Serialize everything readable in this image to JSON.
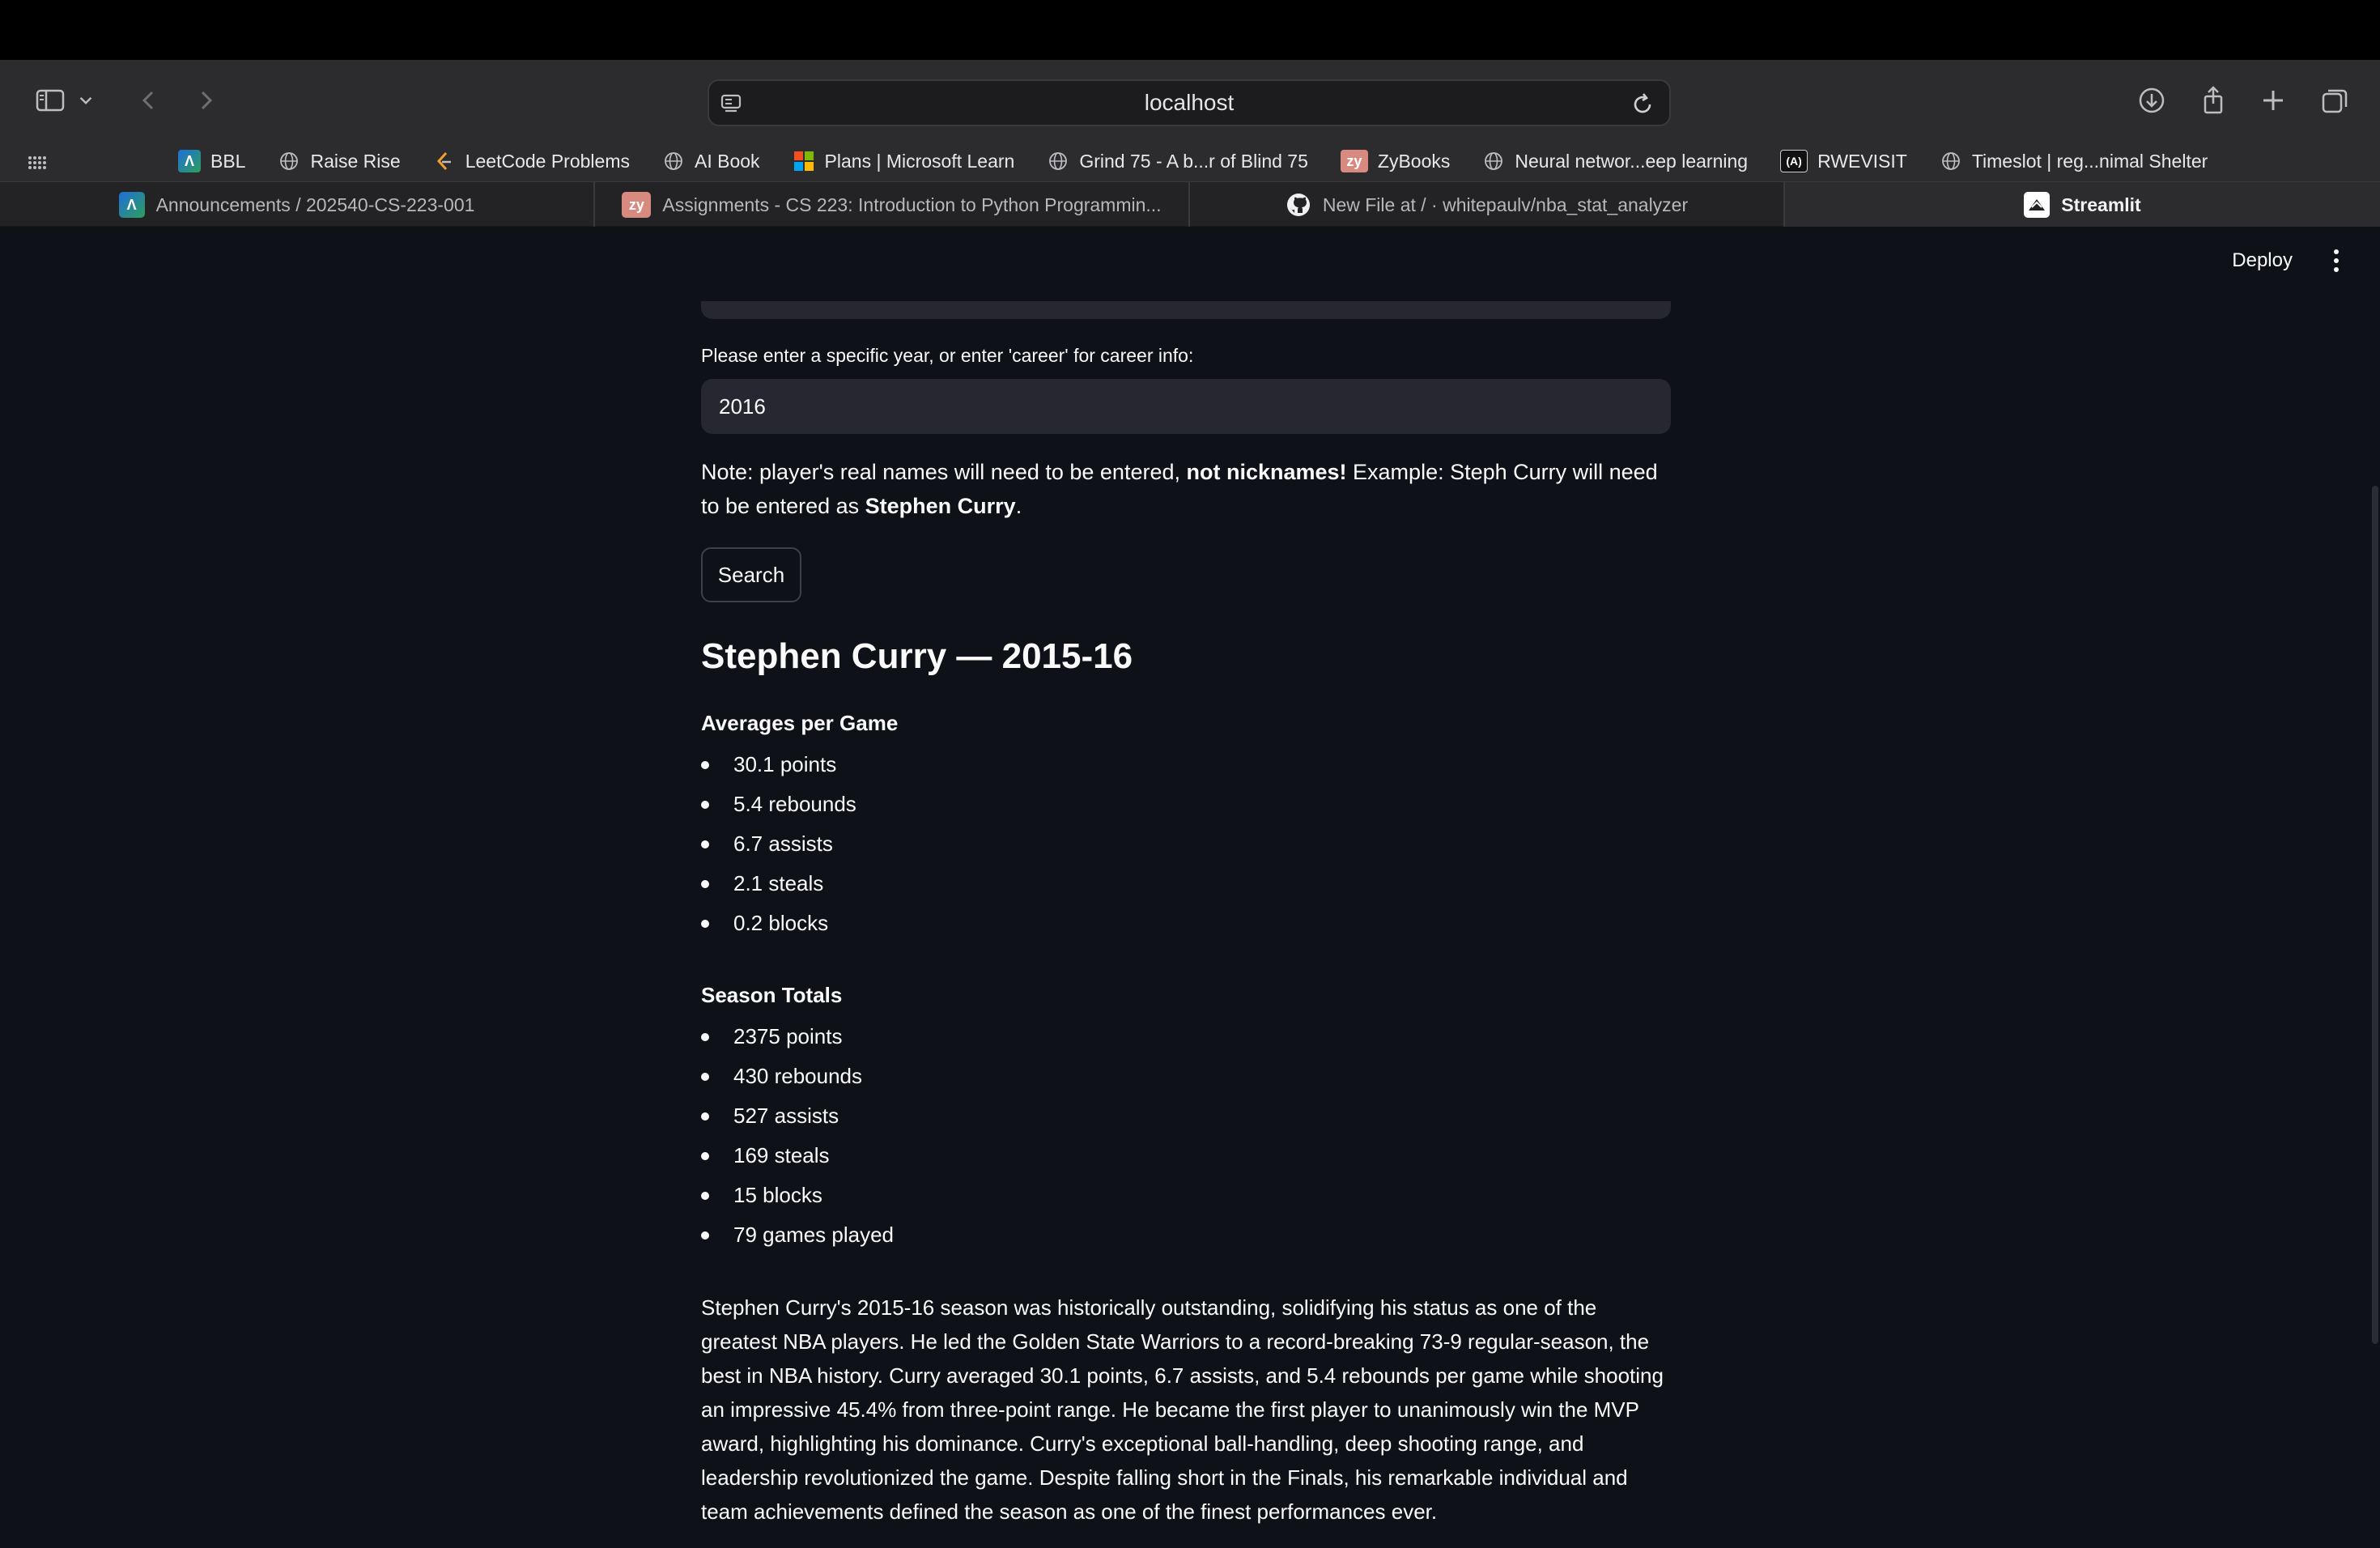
{
  "browser": {
    "url": "localhost",
    "bookmarks": [
      {
        "label": "BBL",
        "icon": "canvas-icon"
      },
      {
        "label": "Raise Rise",
        "icon": "globe-icon"
      },
      {
        "label": "LeetCode Problems",
        "icon": "leetcode-icon"
      },
      {
        "label": "AI Book",
        "icon": "globe-icon"
      },
      {
        "label": "Plans | Microsoft Learn",
        "icon": "microsoft-icon"
      },
      {
        "label": "Grind 75 - A b...r of Blind 75",
        "icon": "globe-icon"
      },
      {
        "label": "ZyBooks",
        "icon": "zybooks-icon"
      },
      {
        "label": "Neural networ...eep learning",
        "icon": "globe-icon"
      },
      {
        "label": "RWEVISIT",
        "icon": "rwe-icon"
      },
      {
        "label": "Timeslot | reg...nimal Shelter",
        "icon": "globe-icon"
      }
    ],
    "tabs": [
      {
        "label": "Announcements / 202540-CS-223-001",
        "icon": "canvas-icon",
        "active": false
      },
      {
        "label": "Assignments - CS 223: Introduction to Python Programmin...",
        "icon": "zybooks-icon",
        "active": false
      },
      {
        "label": "New File at / · whitepaulv/nba_stat_analyzer",
        "icon": "github-icon",
        "active": false
      },
      {
        "label": "Streamlit",
        "icon": "streamlit-icon",
        "active": true
      }
    ]
  },
  "app": {
    "deploy_label": "Deploy",
    "year_label": "Please enter a specific year, or enter 'career' for career info:",
    "year_value": "2016",
    "note_part1": "Note: player's real names will need to be entered, ",
    "note_bold1": "not nicknames!",
    "note_part2": " Example: Steph Curry will need to be entered as ",
    "note_bold2": "Stephen Curry",
    "note_part3": ".",
    "search_label": "Search",
    "heading": "Stephen Curry — 2015-16",
    "averages_title": "Averages per Game",
    "averages": [
      "30.1 points",
      "5.4 rebounds",
      "6.7 assists",
      "2.1 steals",
      "0.2 blocks"
    ],
    "totals_title": "Season Totals",
    "totals": [
      "2375 points",
      "430 rebounds",
      "527 assists",
      "169 steals",
      "15 blocks",
      "79 games played"
    ],
    "summary": "Stephen Curry's 2015-16 season was historically outstanding, solidifying his status as one of the greatest NBA players. He led the Golden State Warriors to a record-breaking 73-9 regular-season, the best in NBA history. Curry averaged 30.1 points, 6.7 assists, and 5.4 rebounds per game while shooting an impressive 45.4% from three-point range. He became the first player to unanimously win the MVP award, highlighting his dominance. Curry's exceptional ball-handling, deep shooting range, and leadership revolutionized the game. Despite falling short in the Finals, his remarkable individual and team achievements defined the season as one of the finest performances ever."
  }
}
